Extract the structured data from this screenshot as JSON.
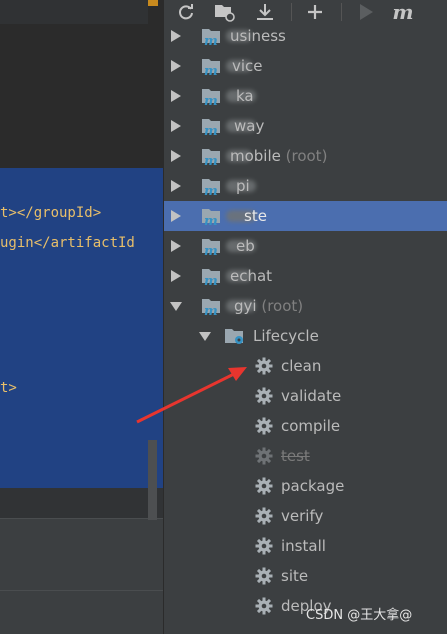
{
  "editor": {
    "lines": [
      {
        "tag": "t></groupId>"
      },
      {
        "tag": "ugin</artifactId"
      },
      {
        "tag": "t>"
      }
    ]
  },
  "toolbar": {
    "icons": [
      "refresh-icon",
      "folder-sync-icon",
      "download-icon",
      "add-icon",
      "run-icon",
      "maven-icon"
    ],
    "maven_label": "m"
  },
  "tree": {
    "modules": [
      {
        "label": "usiness",
        "root": ""
      },
      {
        "label": "vice",
        "root": ""
      },
      {
        "label": "ka",
        "root": ""
      },
      {
        "label": "way",
        "root": ""
      },
      {
        "label": "mobile",
        "root": "(root)"
      },
      {
        "label": "pi",
        "root": ""
      },
      {
        "label": "ste",
        "root": ""
      },
      {
        "label": "eb",
        "root": ""
      },
      {
        "label": "echat",
        "root": ""
      },
      {
        "label": "gyi",
        "root": "(root)"
      }
    ],
    "lifecycle_label": "Lifecycle",
    "phases": [
      "clean",
      "validate",
      "compile",
      "test",
      "package",
      "verify",
      "install",
      "site",
      "deploy"
    ]
  },
  "watermark": "CSDN @王大拿@",
  "colors": {
    "selection": "#4b6eaf",
    "annotation_arrow": "#e8352e"
  }
}
